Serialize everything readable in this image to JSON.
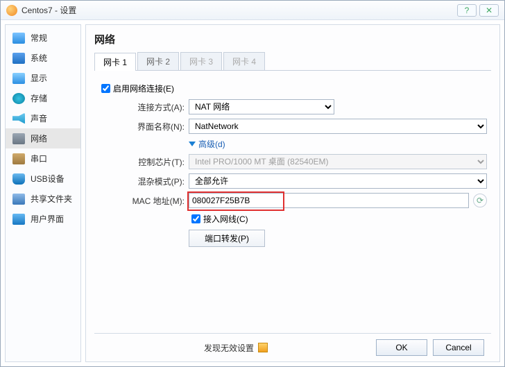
{
  "window": {
    "title": "Centos7 - 设置"
  },
  "sidebar": {
    "items": [
      {
        "label": "常规"
      },
      {
        "label": "系统"
      },
      {
        "label": "显示"
      },
      {
        "label": "存储"
      },
      {
        "label": "声音"
      },
      {
        "label": "网络"
      },
      {
        "label": "串口"
      },
      {
        "label": "USB设备"
      },
      {
        "label": "共享文件夹"
      },
      {
        "label": "用户界面"
      }
    ]
  },
  "main": {
    "heading": "网络",
    "tabs": [
      {
        "label": "网卡 1"
      },
      {
        "label": "网卡 2"
      },
      {
        "label": "网卡 3"
      },
      {
        "label": "网卡 4"
      }
    ],
    "enable_label": "启用网络连接(E)",
    "attach_label": "连接方式(A):",
    "attach_value": "NAT 网络",
    "name_label": "界面名称(N):",
    "name_value": "NatNetwork",
    "advanced_label": "高级(d)",
    "adapter_label": "控制芯片(T):",
    "adapter_value": "Intel PRO/1000 MT 桌面 (82540EM)",
    "promisc_label": "混杂模式(P):",
    "promisc_value": "全部允许",
    "mac_label": "MAC 地址(M):",
    "mac_value": "080027F25B7B",
    "cable_label": "接入网线(C)",
    "portfwd_label": "端口转发(P)"
  },
  "footer": {
    "warning": "发现无效设置",
    "ok": "OK",
    "cancel": "Cancel"
  }
}
